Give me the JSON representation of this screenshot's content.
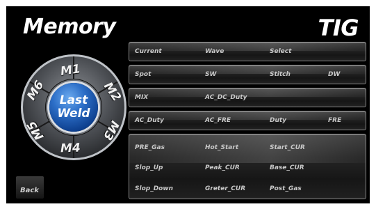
{
  "header": {
    "title": "Memory",
    "mode": "TIG"
  },
  "dial": {
    "segments": [
      "M1",
      "M2",
      "M3",
      "M4",
      "M5",
      "M6"
    ],
    "center_line1": "Last",
    "center_line2": "Weld"
  },
  "back_label": "Back",
  "rows": {
    "r1": [
      "Current",
      "Wave",
      "Select"
    ],
    "r2": [
      "Spot",
      "SW",
      "Stitch",
      "DW"
    ],
    "r3": [
      "MIX",
      "AC_DC_Duty"
    ],
    "r4": [
      "AC_Duty",
      "AC_FRE",
      "Duty",
      "FRE"
    ],
    "r5a": [
      "PRE_Gas",
      "Hot_Start",
      "Start_CUR"
    ],
    "r5b": [
      "Slop_Up",
      "Peak_CUR",
      "Base_CUR"
    ],
    "r5c": [
      "Slop_Down",
      "Greter_CUR",
      "Post_Gas"
    ]
  },
  "colors": {
    "accent_blue": "#2d6fc8",
    "panel_border": "#8a8a8a",
    "background": "#000000"
  }
}
